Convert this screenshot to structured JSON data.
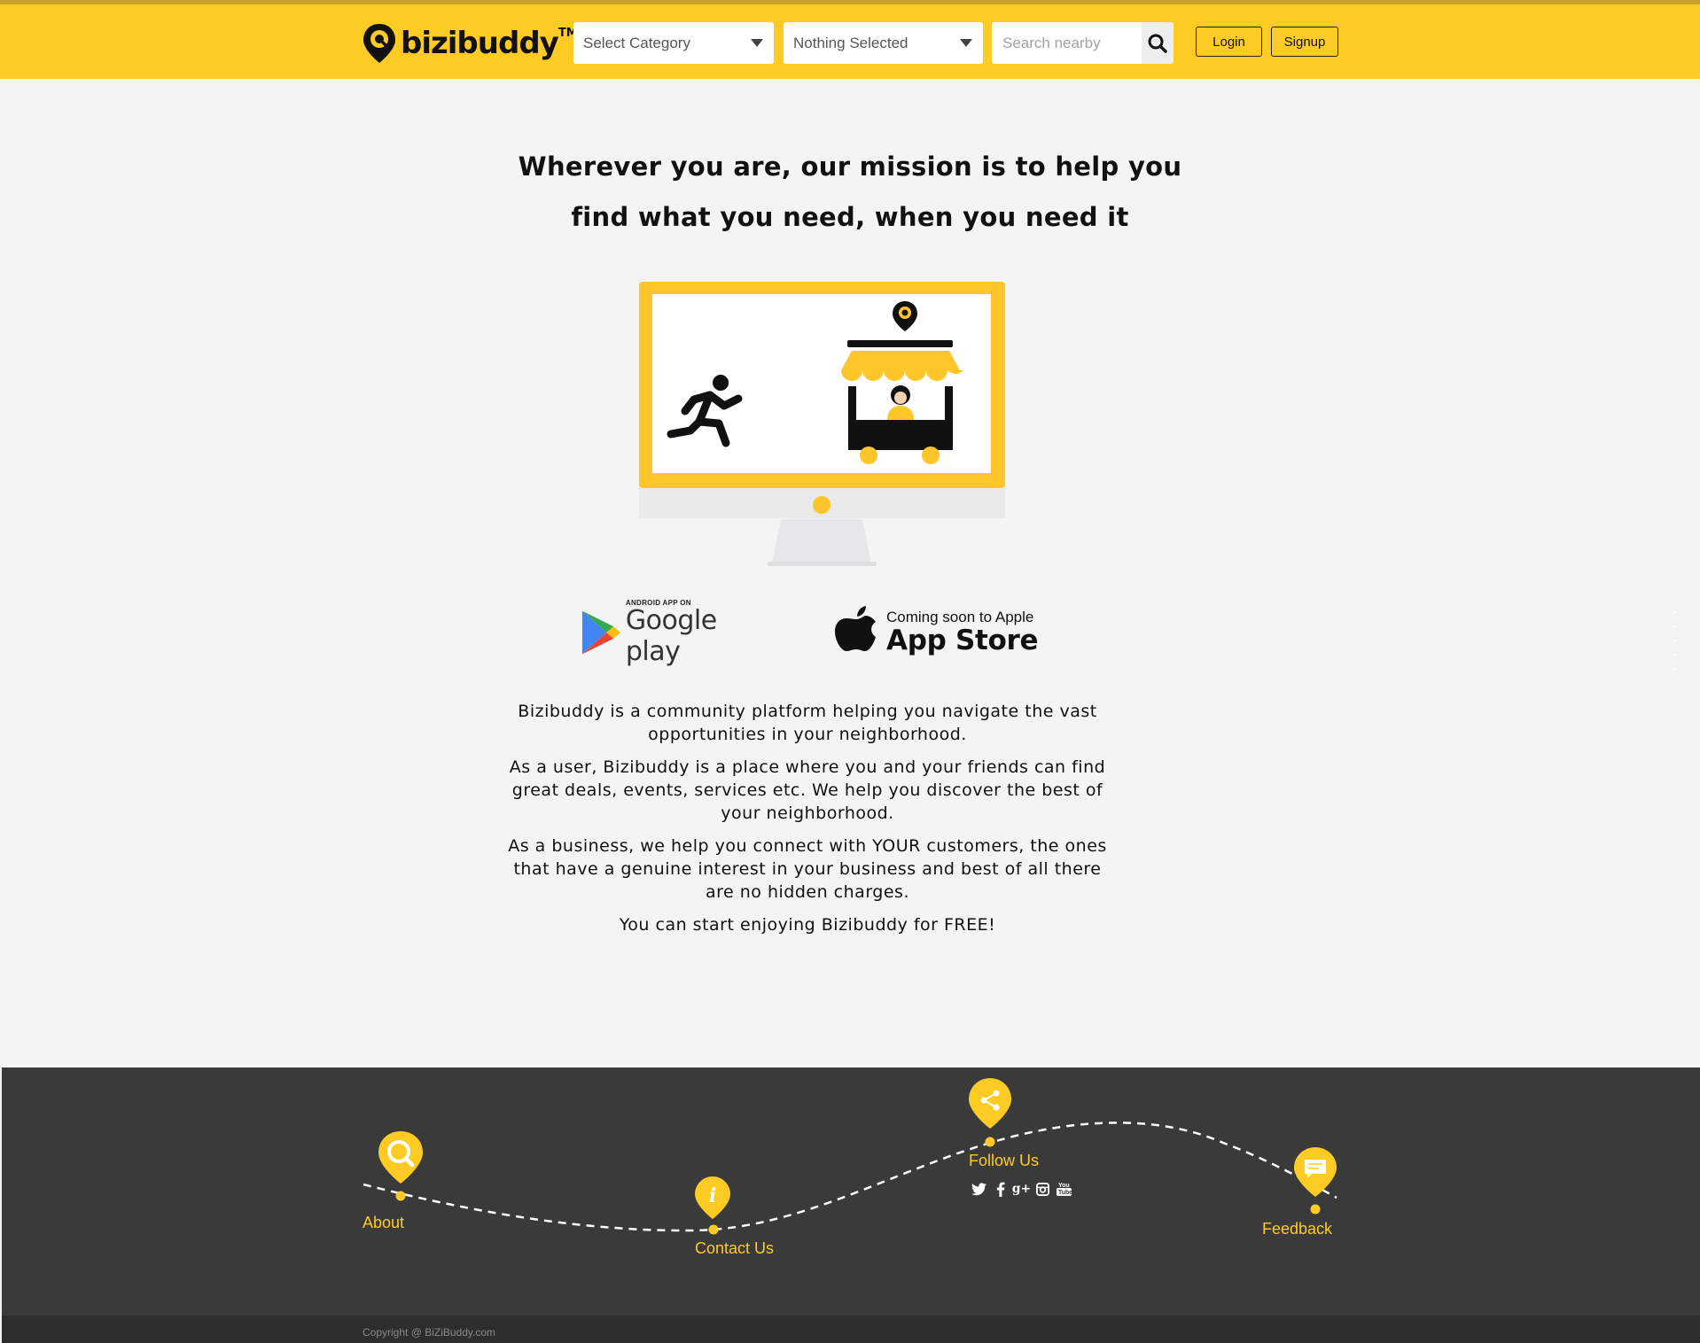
{
  "brand": {
    "name": "bizibuddy",
    "trademark": "TM"
  },
  "header": {
    "category_select": {
      "value": "Select Category"
    },
    "filter_select": {
      "value": "Nothing Selected"
    },
    "search": {
      "placeholder": "Search nearby",
      "value": ""
    },
    "login_label": "Login",
    "signup_label": "Signup"
  },
  "hero": {
    "headline_line1": "Wherever you are, our mission is to help you",
    "headline_line2": "find what you need, when you need it"
  },
  "stores": {
    "google": {
      "small": "ANDROID APP ON",
      "big": "Google play",
      "icon": "google-play-icon"
    },
    "apple": {
      "small": "Coming soon to Apple",
      "big": "App Store",
      "icon": "apple-icon"
    }
  },
  "description": [
    "Bizibuddy is a community platform helping you navigate the vast opportunities in your neighborhood.",
    "As a user, Bizibuddy is a place where you and your friends can find great deals, events, services etc. We help you discover the best of your neighborhood.",
    "As a business, we help you connect with YOUR customers, the ones that have a genuine interest in your business and best of all there are no hidden charges.",
    "You can start enjoying Bizibuddy for FREE!"
  ],
  "footer": {
    "about": "About",
    "contact": "Contact Us",
    "follow": "Follow Us",
    "feedback": "Feedback",
    "social": [
      {
        "name": "twitter-icon",
        "glyph": "t"
      },
      {
        "name": "facebook-icon",
        "glyph": "f"
      },
      {
        "name": "google-plus-icon",
        "glyph": "g+"
      },
      {
        "name": "instagram-icon",
        "glyph": "◙"
      },
      {
        "name": "youtube-icon",
        "glyph": "▶"
      }
    ],
    "copyright": "Copyright @ BiZiBuddy.com"
  },
  "colors": {
    "brand_yellow": "#fecb25",
    "footer_dark": "#3a3a3a",
    "text_dark": "#111111"
  }
}
